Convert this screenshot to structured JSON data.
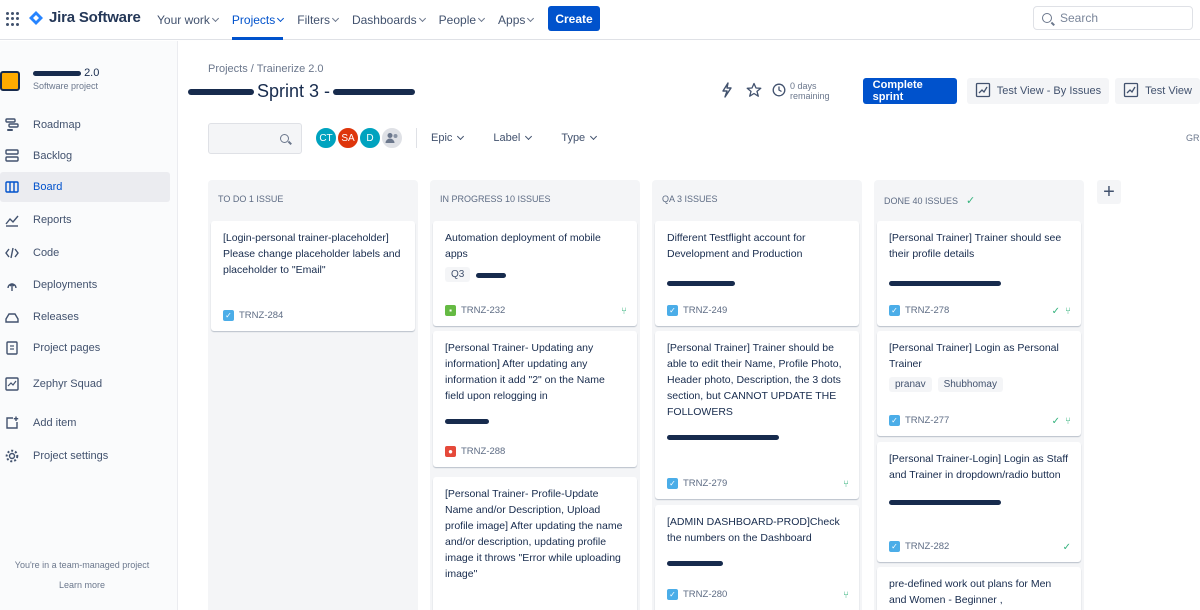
{
  "topbar": {
    "logo_text": "Jira Software",
    "nav": [
      "Your work",
      "Projects",
      "Filters",
      "Dashboards",
      "People",
      "Apps"
    ],
    "create_label": "Create",
    "search_placeholder": "Search"
  },
  "sidebar": {
    "project_name": "2.0",
    "project_type": "Software project",
    "items": [
      {
        "label": "Roadmap",
        "icon": "roadmap-icon"
      },
      {
        "label": "Backlog",
        "icon": "backlog-icon"
      },
      {
        "label": "Board",
        "icon": "board-icon"
      },
      {
        "label": "Reports",
        "icon": "reports-icon"
      },
      {
        "label": "Code",
        "icon": "code-icon"
      },
      {
        "label": "Deployments",
        "icon": "deployments-icon"
      },
      {
        "label": "Releases",
        "icon": "releases-icon"
      },
      {
        "label": "Project pages",
        "icon": "pages-icon"
      },
      {
        "label": "Zephyr Squad",
        "icon": "zephyr-icon"
      },
      {
        "label": "Add item",
        "icon": "add-item-icon"
      },
      {
        "label": "Project settings",
        "icon": "settings-icon"
      }
    ],
    "team_note": "You're in a team-managed project",
    "learn_more": "Learn more"
  },
  "header": {
    "breadcrumb": "Projects  /  Trainerize 2.0",
    "sprint_title": "Sprint 3 -",
    "days_remaining": "0 days remaining",
    "complete_sprint": "Complete sprint",
    "view1": "Test View - By Issues",
    "view2": "Test View"
  },
  "filters": {
    "avatars": [
      {
        "initials": "CT",
        "color": "#00a3bf"
      },
      {
        "initials": "SA",
        "color": "#de350b"
      },
      {
        "initials": "D",
        "color": "#00a3bf"
      }
    ],
    "epic": "Epic",
    "label": "Label",
    "type": "Type",
    "group": "GRO"
  },
  "columns": [
    {
      "title": "TO DO 1 ISSUE",
      "cards": [
        {
          "text": "[Login-personal trainer-placeholder] Please change placeholder labels and placeholder to \"Email\"",
          "key": "TRNZ-284",
          "type": "task"
        }
      ]
    },
    {
      "title": "IN PROGRESS 10 ISSUES",
      "cards": [
        {
          "text": "Automation deployment of mobile apps",
          "tag": "Q3",
          "key": "TRNZ-232",
          "type": "story"
        },
        {
          "text": "[Personal Trainer- Updating any information] After updating any information it add \"2\" on the Name field upon relogging in",
          "key": "TRNZ-288",
          "type": "bug"
        },
        {
          "text": "[Personal Trainer- Profile-Update Name and/or Description, Upload profile image] After updating the name and/or description, updating profile image it throws \"Error while uploading image\"",
          "key": ""
        }
      ]
    },
    {
      "title": "QA 3 ISSUES",
      "cards": [
        {
          "text": "Different Testflight account for Development and Production",
          "key": "TRNZ-249",
          "type": "task"
        },
        {
          "text": "[Personal Trainer] Trainer should be able to edit their Name, Profile Photo, Header photo, Description, the 3 dots section, but CANNOT UPDATE THE FOLLOWERS",
          "key": "TRNZ-279",
          "type": "task"
        },
        {
          "text": "[ADMIN DASHBOARD-PROD]Check the numbers on the Dashboard",
          "key": "TRNZ-280",
          "type": "task"
        }
      ]
    },
    {
      "title": "DONE 40 ISSUES",
      "cards": [
        {
          "text": "[Personal Trainer] Trainer should see their profile details",
          "key": "TRNZ-278",
          "type": "task"
        },
        {
          "text": "[Personal Trainer] Login as Personal Trainer",
          "tags": [
            "pranav",
            "Shubhomay"
          ],
          "key": "TRNZ-277",
          "type": "task"
        },
        {
          "text": "[Personal Trainer-Login] Login as Staff and Trainer in dropdown/radio button",
          "key": "TRNZ-282",
          "type": "task"
        },
        {
          "text": "pre-defined work out plans for Men and Women - Beginner ,",
          "key": ""
        }
      ]
    }
  ]
}
